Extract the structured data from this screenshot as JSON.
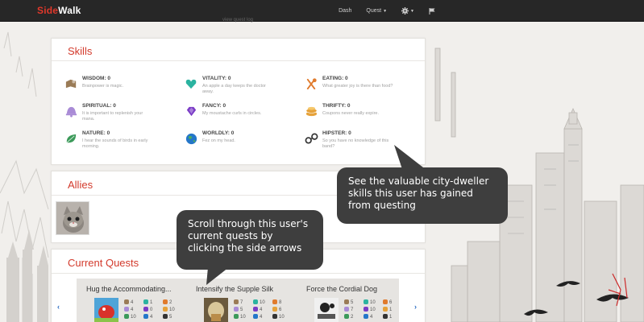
{
  "nav": {
    "brand_prefix": "Side",
    "brand_suffix": "Walk",
    "dash": "Dash",
    "quest": "Quest",
    "subline": "view quest log"
  },
  "skills": {
    "title": "Skills",
    "items": [
      {
        "name": "WISDOM: 0",
        "desc": "Brainpower is magic.",
        "icon": "wisdom-icon",
        "color": "#9a7b56"
      },
      {
        "name": "VITALITY: 0",
        "desc": "An apple a day keeps the doctor away.",
        "icon": "heart-icon",
        "color": "#2bb3a0"
      },
      {
        "name": "EATING: 0",
        "desc": "What greater joy is there than food?",
        "icon": "fork-spoon-icon",
        "color": "#e07b2d"
      },
      {
        "name": "SPIRITUAL: 0",
        "desc": "It is important to replenish your mana.",
        "icon": "bell-icon",
        "color": "#a98bd6"
      },
      {
        "name": "FANCY: 0",
        "desc": "My moustache curls in circles.",
        "icon": "gem-icon",
        "color": "#7a3bc6"
      },
      {
        "name": "THRIFTY: 0",
        "desc": "Coupons never really expire.",
        "icon": "coins-icon",
        "color": "#e6a23a"
      },
      {
        "name": "NATURE: 0",
        "desc": "I hear the sounds of birds in early morning.",
        "icon": "leaf-icon",
        "color": "#3c9a5a"
      },
      {
        "name": "WORLDLY: 0",
        "desc": "Fez on my head.",
        "icon": "globe-icon",
        "color": "#2476c9"
      },
      {
        "name": "HIPSTER: 0",
        "desc": "So you have no knowledge of this band?",
        "icon": "glasses-icon",
        "color": "#333333"
      }
    ]
  },
  "allies": {
    "title": "Allies"
  },
  "quests": {
    "title": "Current Quests",
    "items": [
      {
        "title": "Hug the Accommodating...",
        "stats": [
          "4",
          "1",
          "2",
          "4",
          "0",
          "10",
          "10",
          "4",
          "5"
        ]
      },
      {
        "title": "Intensify the Supple Silk",
        "stats": [
          "7",
          "10",
          "8",
          "5",
          "4",
          "6",
          "10",
          "4",
          "10"
        ]
      },
      {
        "title": "Force the Cordial Dog",
        "stats": [
          "5",
          "10",
          "6",
          "7",
          "10",
          "1",
          "2",
          "4",
          "1"
        ]
      }
    ]
  },
  "tooltips": {
    "skills": "See the valuable city-dweller skills this user has gained from questing",
    "quests": "Scroll through this user's current quests by clicking the side arrows"
  }
}
